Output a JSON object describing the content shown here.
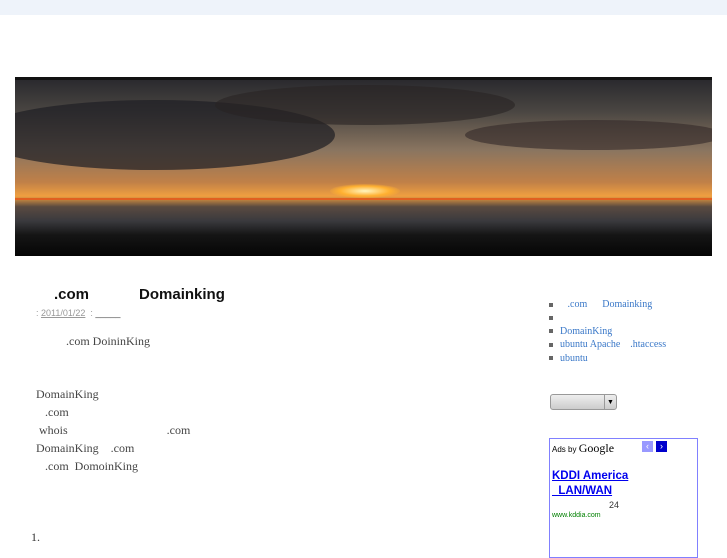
{
  "post": {
    "title": ".com            Domainking",
    "date_prefix": ": ",
    "date": "2011/01/22",
    "author_prefix": "  : ",
    "author": "_____",
    "lines": [
      "          .com DoininKing",
      "",
      "",
      "DomainKing",
      "   .com",
      " whois                                 .com",
      "DomainKing    .com",
      "   .com  DomoinKing"
    ],
    "list_marker": "1."
  },
  "sidebar": {
    "links": [
      "   .com      Domainking",
      "",
      "DomainKing",
      "ubuntu Apache    .htaccess",
      "ubuntu"
    ],
    "select_value": ""
  },
  "ad": {
    "ads_by": "Ads by",
    "google": "Google",
    "prev_icon": "‹",
    "next_icon": "›",
    "title1": "KDDI America",
    "title2": "  LAN/WAN",
    "desc": "24",
    "url": "www.kddia.com"
  }
}
